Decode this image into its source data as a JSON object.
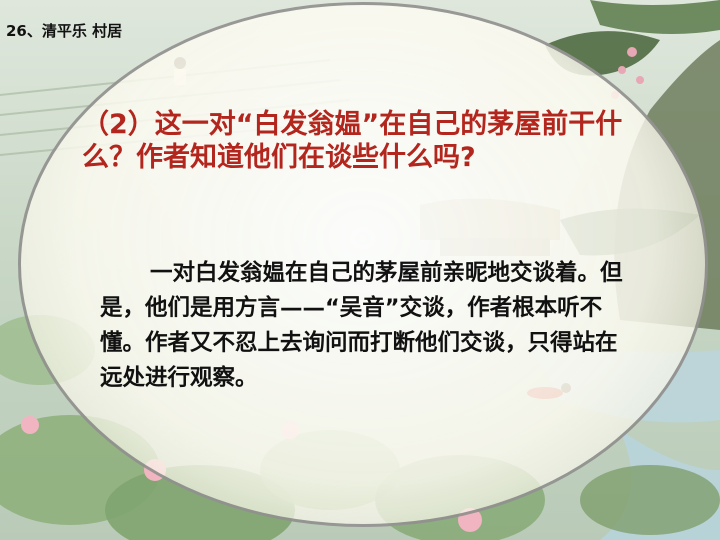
{
  "slide": {
    "header": "26、清平乐 村居",
    "question": "（2）这一对“白发翁媪”在自己的茅屋前干什么？作者知道他们在谈些什么吗?",
    "answer": "一对白发翁媪在自己的茅屋前亲昵地交谈着。但是，他们是用方言——“吴音”交谈，作者根本听不懂。作者又不忍上去询问而打断他们交谈，只得站在远处进行观察。"
  },
  "colors": {
    "question_text": "#b3261e",
    "answer_text": "#111111",
    "oval_border": "#7a7a7a",
    "background_green": "#c9d6c4"
  }
}
